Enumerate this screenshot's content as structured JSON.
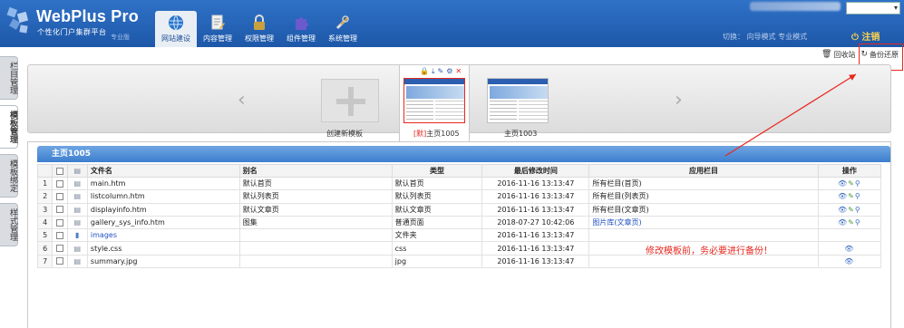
{
  "app": {
    "title": "WebPlus Pro",
    "subtitle": "个性化门户集群平台",
    "edition": "专业版"
  },
  "nav": {
    "items": [
      {
        "label": "网站建设",
        "icon": "globe-icon",
        "active": true
      },
      {
        "label": "内容管理",
        "icon": "document-edit-icon",
        "active": false
      },
      {
        "label": "权限管理",
        "icon": "lock-icon",
        "active": false
      },
      {
        "label": "组件管理",
        "icon": "puzzle-icon",
        "active": false
      },
      {
        "label": "系统管理",
        "icon": "tools-icon",
        "active": false
      }
    ]
  },
  "header_right": {
    "switch_text": "切换： 向导模式 专业模式",
    "logout_label": "注销"
  },
  "side_tabs": [
    "栏目管理",
    "模板管理",
    "模板绑定",
    "样式管理"
  ],
  "side_tab_active": "模板管理",
  "toolbar": {
    "recycle_label": "回收站",
    "backup_label": "备份还原"
  },
  "templates": {
    "create_label": "创建新模板",
    "items": [
      {
        "default_tag": "[默]",
        "name": "主页1005",
        "active": true
      },
      {
        "default_tag": "",
        "name": "主页1003",
        "active": false
      }
    ]
  },
  "panel": {
    "title": "主页1005",
    "columns": [
      "文件名",
      "别名",
      "类型",
      "最后修改时间",
      "应用栏目",
      "操作"
    ],
    "rows": [
      {
        "n": "1",
        "name": "main.htm",
        "alias": "默认首页",
        "type": "默认首页",
        "time": "2016-11-16 13:13:47",
        "col": "所有栏目(首页)",
        "col_link": false,
        "ops": "full",
        "folder": false
      },
      {
        "n": "2",
        "name": "listcolumn.htm",
        "alias": "默认列表页",
        "type": "默认列表页",
        "time": "2016-11-16 13:13:47",
        "col": "所有栏目(列表页)",
        "col_link": false,
        "ops": "full",
        "folder": false
      },
      {
        "n": "3",
        "name": "displayinfo.htm",
        "alias": "默认文章页",
        "type": "默认文章页",
        "time": "2016-11-16 13:13:47",
        "col": "所有栏目(文章页)",
        "col_link": false,
        "ops": "full",
        "folder": false
      },
      {
        "n": "4",
        "name": "gallery_sys_info.htm",
        "alias": "图集",
        "type": "普通页面",
        "time": "2018-07-27 10:42:06",
        "col": "图片库(文章页)",
        "col_link": true,
        "ops": "full",
        "folder": false
      },
      {
        "n": "5",
        "name": "images",
        "alias": "",
        "type": "文件夹",
        "time": "2016-11-16 13:13:47",
        "col": "",
        "col_link": false,
        "ops": "none",
        "folder": true
      },
      {
        "n": "6",
        "name": "style.css",
        "alias": "",
        "type": "css",
        "time": "2016-11-16 13:13:47",
        "col": "",
        "col_link": false,
        "ops": "view",
        "folder": false
      },
      {
        "n": "7",
        "name": "summary.jpg",
        "alias": "",
        "type": "jpg",
        "time": "2016-11-16 13:13:47",
        "col": "",
        "col_link": false,
        "ops": "view",
        "folder": false
      }
    ]
  },
  "annotation": {
    "note": "修改模板前，务必要进行备份！",
    "color": "#e6271e"
  },
  "colors": {
    "header": "#1d57a8",
    "accent_red": "#e6271e",
    "link_blue": "#2152c4"
  }
}
